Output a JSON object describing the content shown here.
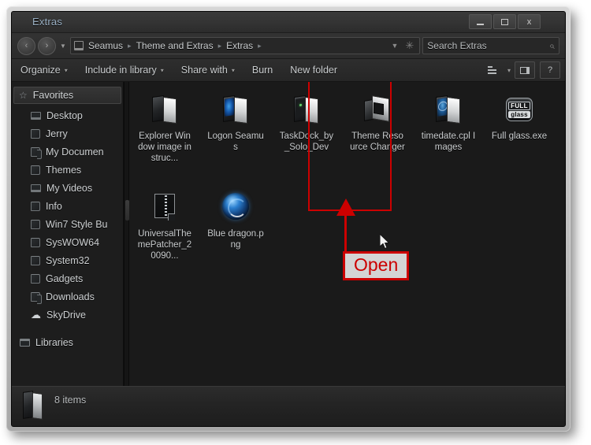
{
  "window": {
    "title": "Extras",
    "controls": {
      "minimize": "minimize",
      "maximize": "maximize",
      "close": "x"
    }
  },
  "address": {
    "back": "‹",
    "forward": "›",
    "history_caret": "▼",
    "computer_icon": "computer-icon",
    "breadcrumbs": [
      "Seamus",
      "Theme and Extras",
      "Extras"
    ],
    "separator": "▸",
    "dropdown_caret": "▼",
    "refresh_icon": "✳"
  },
  "search": {
    "placeholder": "Search Extras",
    "value": "",
    "icon": "⌕"
  },
  "toolbar": {
    "items": [
      {
        "label": "Organize",
        "caret": "▾"
      },
      {
        "label": "Include in library",
        "caret": "▾"
      },
      {
        "label": "Share with",
        "caret": "▾"
      },
      {
        "label": "Burn",
        "caret": ""
      },
      {
        "label": "New folder",
        "caret": ""
      }
    ],
    "view_caret": "▾",
    "preview_pane": "preview-pane",
    "help": "?"
  },
  "sidebar": {
    "items": [
      {
        "label": "Favorites",
        "icon": "star-icon",
        "type": "header"
      },
      {
        "label": "Desktop",
        "icon": "monitor-icon",
        "type": "item"
      },
      {
        "label": "Jerry",
        "icon": "folder-icon",
        "type": "item"
      },
      {
        "label": "My Documen",
        "icon": "folder-open-icon",
        "type": "item"
      },
      {
        "label": "Themes",
        "icon": "folder-icon",
        "type": "item"
      },
      {
        "label": "My Videos",
        "icon": "monitor-icon",
        "type": "item"
      },
      {
        "label": "Info",
        "icon": "folder-icon",
        "type": "item"
      },
      {
        "label": "Win7 Style Bu",
        "icon": "folder-icon",
        "type": "item"
      },
      {
        "label": "SysWOW64",
        "icon": "folder-icon",
        "type": "item"
      },
      {
        "label": "System32",
        "icon": "folder-icon",
        "type": "item"
      },
      {
        "label": "Gadgets",
        "icon": "folder-icon",
        "type": "item"
      },
      {
        "label": "Downloads",
        "icon": "folder-open-icon",
        "type": "item"
      },
      {
        "label": "SkyDrive",
        "icon": "cloud-icon",
        "type": "item"
      },
      {
        "label": "Libraries",
        "icon": "library-icon",
        "type": "header2"
      }
    ]
  },
  "files": [
    {
      "name": "Explorer Window image instruc...",
      "icon": "folder-book-icon"
    },
    {
      "name": "Logon Seamus",
      "icon": "folder-book-blue-icon"
    },
    {
      "name": "TaskDock_by_Solo_Dev",
      "icon": "folder-book-dark-icon"
    },
    {
      "name": "Theme Resource Changer",
      "icon": "folder-3d-icon",
      "selected": true
    },
    {
      "name": "timedate.cpl Images",
      "icon": "folder-book-globe-icon"
    },
    {
      "name": "Full glass.exe",
      "icon": "full-glass-app-icon",
      "icon_text_top": "FULL",
      "icon_text_bottom": "glass"
    },
    {
      "name": "UniversalThemePatcher_20090...",
      "icon": "zip-archive-icon"
    },
    {
      "name": "Blue dragon.png",
      "icon": "blue-dragon-image-icon"
    }
  ],
  "annotation": {
    "label": "Open",
    "color": "#cc0000",
    "label_bg": "#d4d4d4"
  },
  "status": {
    "text": "8 items",
    "icon": "folder-icon"
  }
}
